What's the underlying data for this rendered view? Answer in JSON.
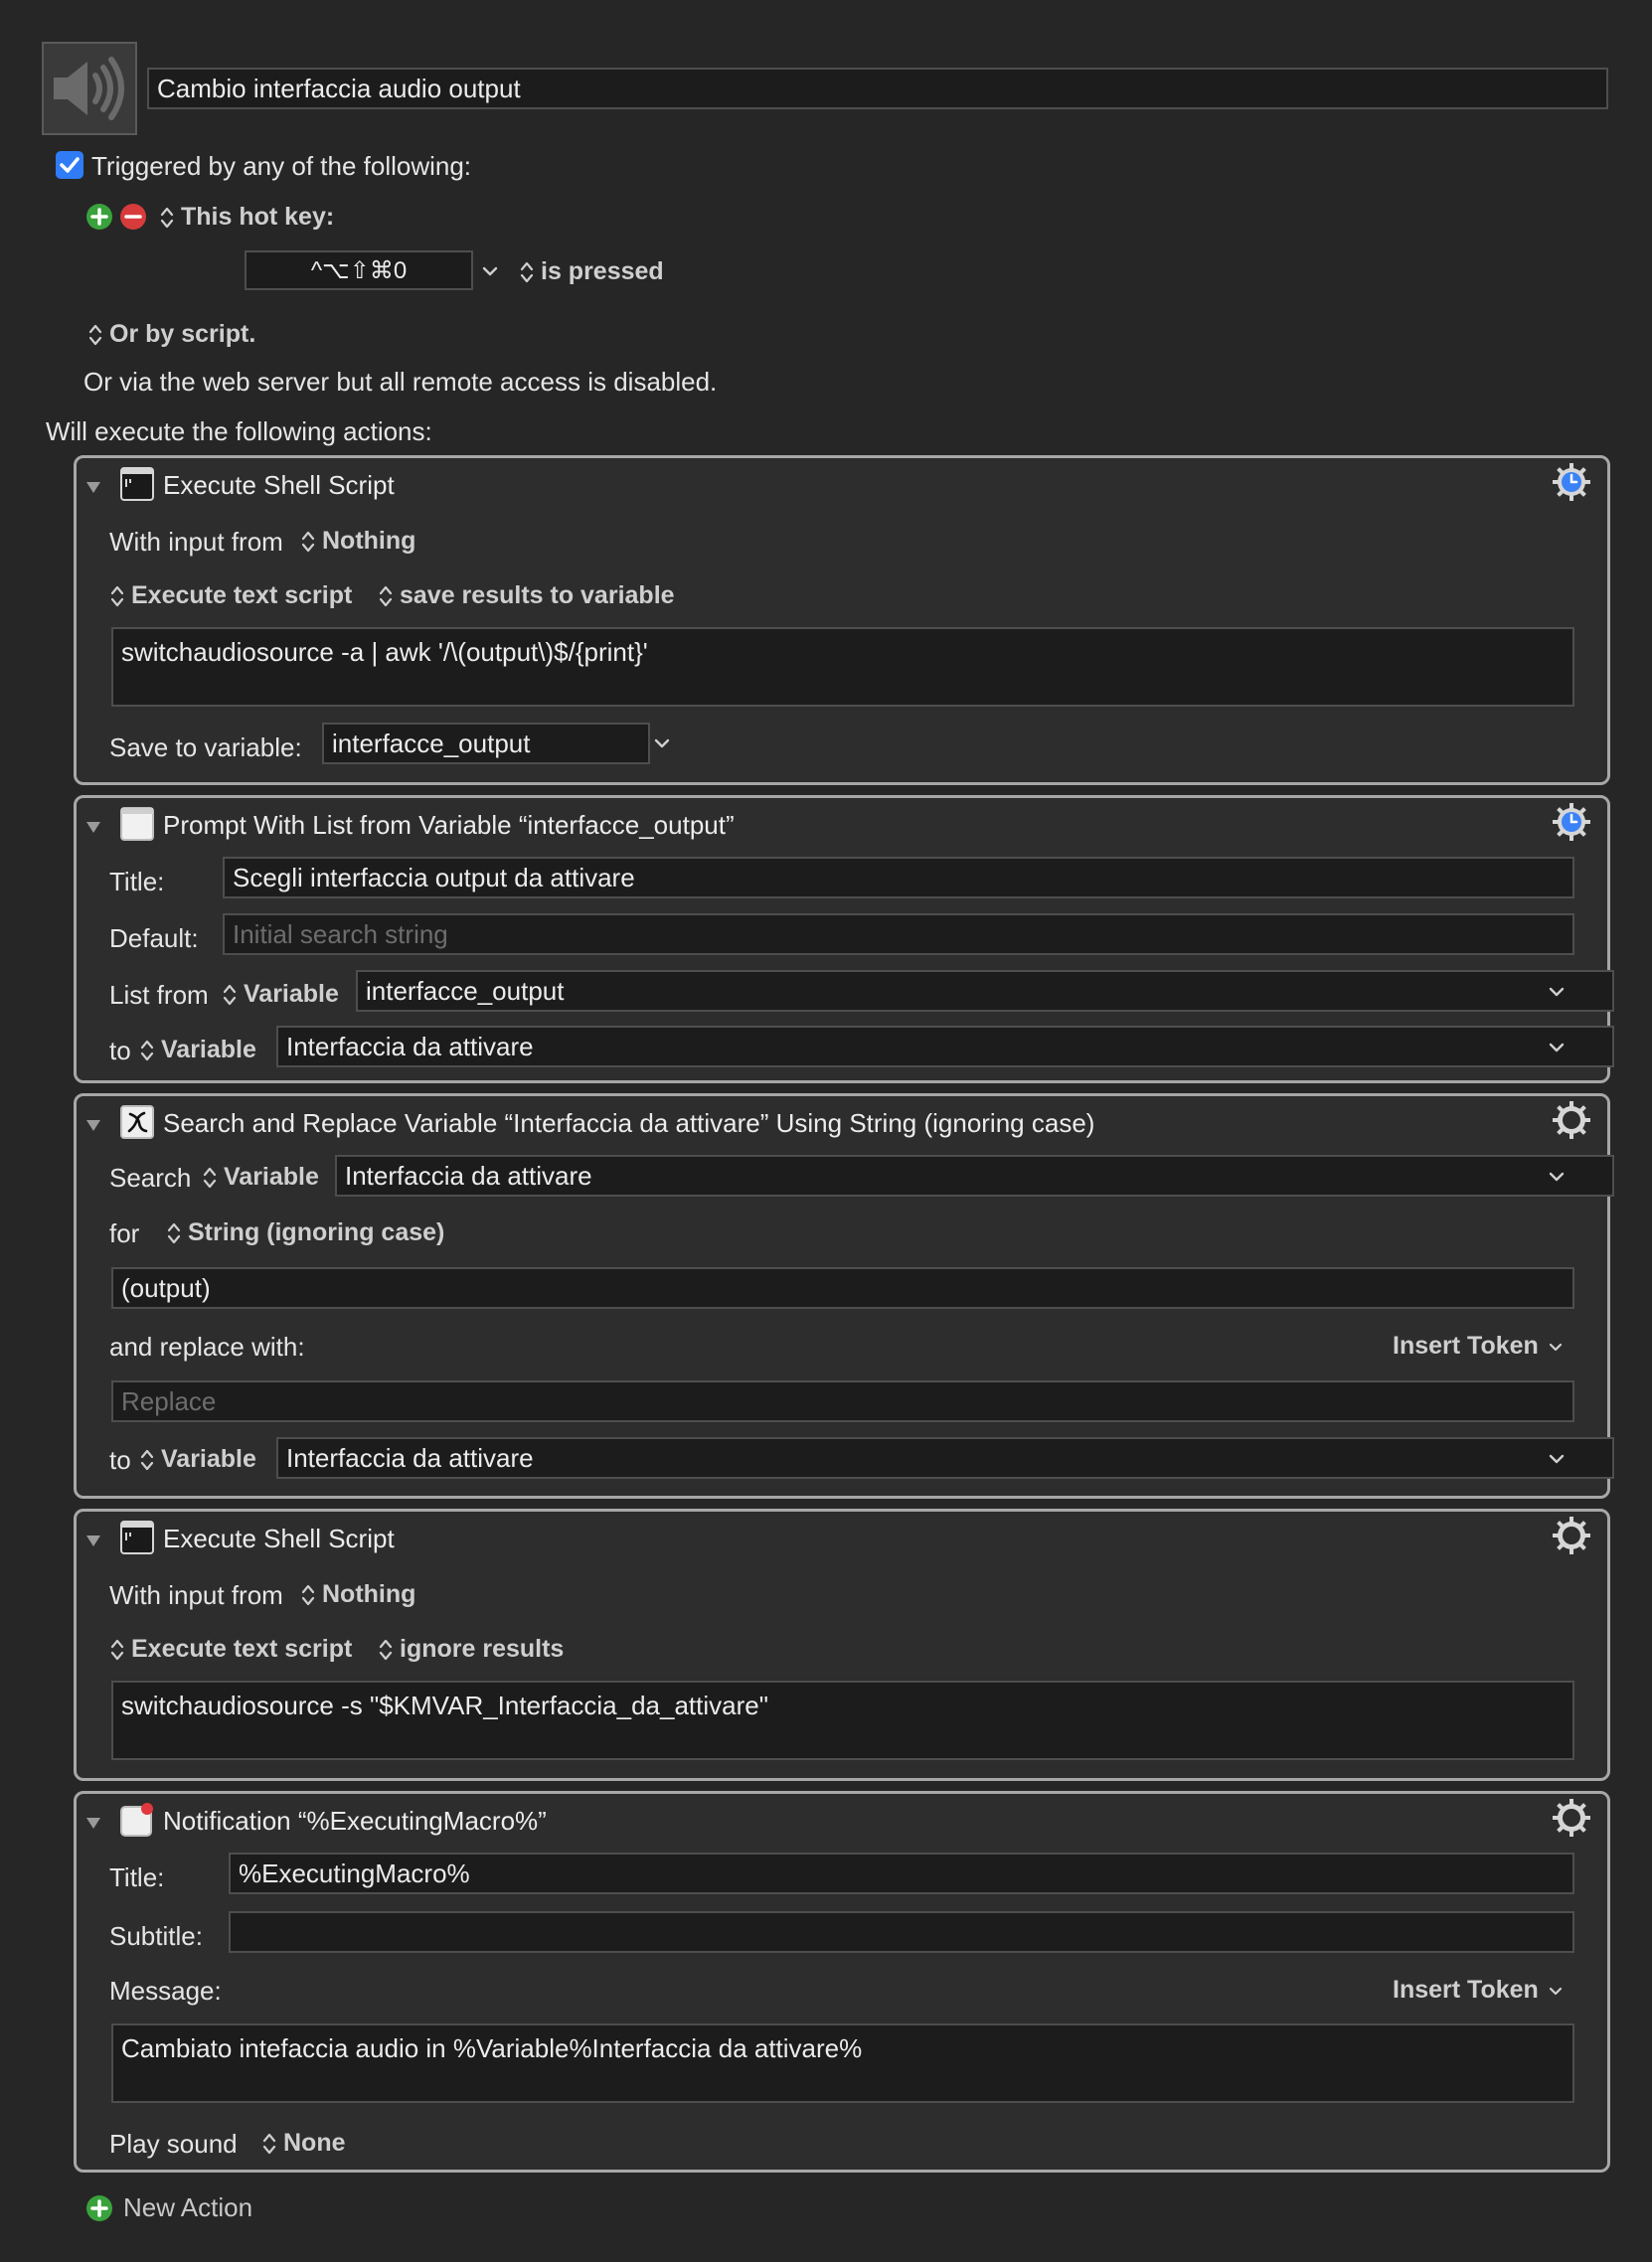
{
  "macro": {
    "name": "Cambio interfaccia audio output",
    "icon": "speaker-icon"
  },
  "trigger": {
    "checkbox_label": "Triggered by any of the following:",
    "hotkey_type": "This hot key:",
    "hotkey_value": "^⌥⇧⌘0",
    "hotkey_mode": "is pressed",
    "by_script": "Or by script.",
    "web_server_note": "Or via the web server but all remote access is disabled."
  },
  "actions_header": "Will execute the following actions:",
  "actions": [
    {
      "title": "Execute Shell Script",
      "input_label": "With input from",
      "input_value": "Nothing",
      "mode": "Execute text script",
      "result_mode": "save results to variable",
      "script": "switchaudiosource -a | awk '/\\(output\\)$/{print}'",
      "save_label": "Save to variable:",
      "save_value": "interfacce_output"
    },
    {
      "title": "Prompt With List from Variable “interfacce_output”",
      "title_label": "Title:",
      "title_value": "Scegli interfaccia output da attivare",
      "default_label": "Default:",
      "default_placeholder": "Initial search string",
      "list_from_label": "List from",
      "list_from_type": "Variable",
      "list_from_value": "interfacce_output",
      "to_label": "to",
      "to_type": "Variable",
      "to_value": "Interfaccia da attivare"
    },
    {
      "title": "Search and Replace Variable “Interfaccia da attivare” Using String (ignoring case)",
      "search_label": "Search",
      "search_type": "Variable",
      "search_value": "Interfaccia da attivare",
      "for_label": "for",
      "for_type": "String (ignoring case)",
      "for_value": " (output)",
      "replace_label": "and replace with:",
      "insert_token": "Insert Token",
      "replace_placeholder": "Replace",
      "to_label": "to",
      "to_type": "Variable",
      "to_value": "Interfaccia da attivare"
    },
    {
      "title": "Execute Shell Script",
      "input_label": "With input from",
      "input_value": "Nothing",
      "mode": "Execute text script",
      "result_mode": "ignore results",
      "script": "switchaudiosource -s \"$KMVAR_Interfaccia_da_attivare\""
    },
    {
      "title": "Notification “%ExecutingMacro%”",
      "title_label": "Title:",
      "title_value": "%ExecutingMacro%",
      "subtitle_label": "Subtitle:",
      "subtitle_value": "",
      "message_label": "Message:",
      "insert_token": "Insert Token",
      "message_value": "Cambiato intefaccia audio in %Variable%Interfaccia da attivare%",
      "sound_label": "Play sound",
      "sound_value": "None"
    }
  ],
  "new_action": "New Action",
  "colors": {
    "background": "#262626",
    "action_border": "#a7a7a7",
    "gear_blue": "#3b82f6",
    "checkbox_blue": "#2f7cf6",
    "add_green": "#3aa23c",
    "remove_red": "#d83b3b"
  }
}
